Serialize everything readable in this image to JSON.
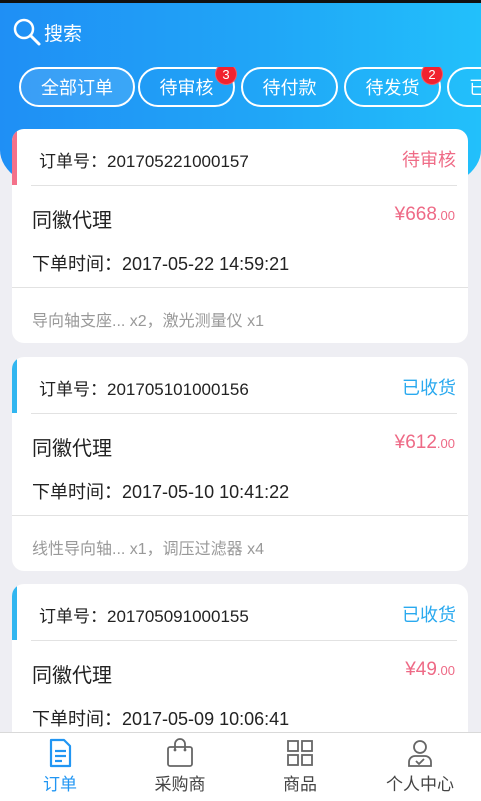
{
  "header": {
    "search_label": "搜索"
  },
  "tabs": [
    {
      "label": "全部订单",
      "badge": ""
    },
    {
      "label": "待审核",
      "badge": "3"
    },
    {
      "label": "待付款",
      "badge": ""
    },
    {
      "label": "待发货",
      "badge": "2"
    },
    {
      "label": "已",
      "badge": ""
    }
  ],
  "orders": [
    {
      "order_no": "订单号：201705221000157",
      "status": "待审核",
      "status_color": "#ef6b86",
      "bar_color": "#f4718a",
      "agent": "同徽代理",
      "price_main": "¥668",
      "price_dec": ".00",
      "time": "下单时间：2017-05-22 14:59:21",
      "items": "导向轴支座... x2，激光测量仪 x1"
    },
    {
      "order_no": "订单号：201705101000156",
      "status": "已收货",
      "status_color": "#2aa9ef",
      "bar_color": "#31b6f0",
      "agent": "同徽代理",
      "price_main": "¥612",
      "price_dec": ".00",
      "time": "下单时间：2017-05-10 10:41:22",
      "items": "线性导向轴... x1，调压过滤器 x4"
    },
    {
      "order_no": "订单号：201705091000155",
      "status": "已收货",
      "status_color": "#2aa9ef",
      "bar_color": "#31b6f0",
      "agent": "同徽代理",
      "price_main": "¥49",
      "price_dec": ".00",
      "time": "下单时间：2017-05-09 10:06:41",
      "items": ""
    }
  ],
  "nav": [
    {
      "label": "订单",
      "icon": "order-doc-icon"
    },
    {
      "label": "采购商",
      "icon": "shopping-bag-icon"
    },
    {
      "label": "商品",
      "icon": "grid-icon"
    },
    {
      "label": "个人中心",
      "icon": "user-icon"
    }
  ],
  "colors": {
    "accent": "#2196f3",
    "price": "#ee6a86"
  }
}
